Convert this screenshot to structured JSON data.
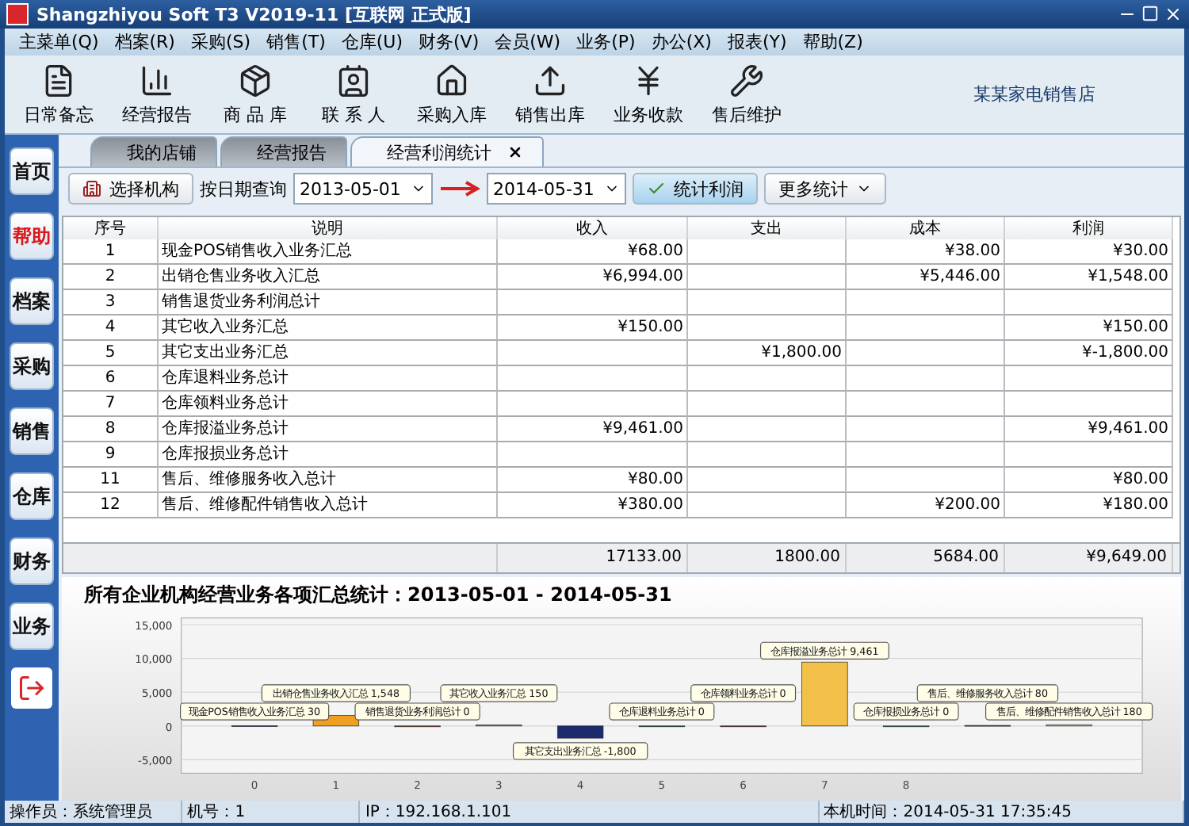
{
  "window": {
    "title": "Shangzhiyou Soft T3 V2019-11 [互联网 正式版]"
  },
  "menu": [
    "主菜单(Q)",
    "档案(R)",
    "采购(S)",
    "销售(T)",
    "仓库(U)",
    "财务(V)",
    "会员(W)",
    "业务(P)",
    "办公(X)",
    "报表(Y)",
    "帮助(Z)"
  ],
  "toolbar": [
    {
      "label": "日常备忘",
      "kind": "memo"
    },
    {
      "label": "经营报告",
      "kind": "report"
    },
    {
      "label": "商 品 库",
      "kind": "goods"
    },
    {
      "label": "联 系 人",
      "kind": "contact"
    },
    {
      "label": "采购入库",
      "kind": "purchase"
    },
    {
      "label": "销售出库",
      "kind": "sale"
    },
    {
      "label": "业务收款",
      "kind": "receipt"
    },
    {
      "label": "售后维护",
      "kind": "service"
    }
  ],
  "store_name": "某某家电销售店",
  "sidebar": {
    "items": [
      {
        "label": "首页",
        "selected": false
      },
      {
        "label": "帮助",
        "selected": true
      },
      {
        "label": "档案",
        "selected": false
      },
      {
        "label": "采购",
        "selected": false
      },
      {
        "label": "销售",
        "selected": false
      },
      {
        "label": "仓库",
        "selected": false
      },
      {
        "label": "财务",
        "selected": false
      },
      {
        "label": "业务",
        "selected": false
      }
    ]
  },
  "tabs": [
    {
      "label": "我的店铺",
      "selected": false,
      "closable": false
    },
    {
      "label": "经营报告",
      "selected": false,
      "closable": false
    },
    {
      "label": "经营利润统计",
      "selected": true,
      "closable": true
    }
  ],
  "filter": {
    "org_button": "选择机构",
    "date_label": "按日期查询",
    "date_from": "2013-05-01",
    "date_to": "2014-05-31",
    "stat_button": "统计利润",
    "more_button": "更多统计"
  },
  "table": {
    "columns": [
      "序号",
      "说明",
      "收入",
      "支出",
      "成本",
      "利润"
    ],
    "rows": [
      [
        "1",
        "现金POS销售收入业务汇总",
        "¥68.00",
        "",
        "¥38.00",
        "¥30.00"
      ],
      [
        "2",
        "出销仓售业务收入汇总",
        "¥6,994.00",
        "",
        "¥5,446.00",
        "¥1,548.00"
      ],
      [
        "3",
        "销售退货业务利润总计",
        "",
        "",
        "",
        ""
      ],
      [
        "4",
        "其它收入业务汇总",
        "¥150.00",
        "",
        "",
        "¥150.00"
      ],
      [
        "5",
        "其它支出业务汇总",
        "",
        "¥1,800.00",
        "",
        "¥-1,800.00"
      ],
      [
        "6",
        "仓库退料业务总计",
        "",
        "",
        "",
        ""
      ],
      [
        "7",
        "仓库领料业务总计",
        "",
        "",
        "",
        ""
      ],
      [
        "8",
        "仓库报溢业务总计",
        "¥9,461.00",
        "",
        "",
        "¥9,461.00"
      ],
      [
        "9",
        "仓库报损业务总计",
        "",
        "",
        "",
        ""
      ],
      [
        "11",
        "售后、维修服务收入总计",
        "¥80.00",
        "",
        "",
        "¥80.00"
      ],
      [
        "12",
        "售后、维修配件销售收入总计",
        "¥380.00",
        "",
        "¥200.00",
        "¥180.00"
      ]
    ],
    "totals": [
      "17133.00",
      "1800.00",
      "5684.00",
      "¥9,649.00"
    ]
  },
  "chart": {
    "chart_data": {
      "type": "bar",
      "title": "所有企业机构经营业务各项汇总统计：2013-05-01 - 2014-05-31",
      "x": [
        0,
        1,
        2,
        3,
        4,
        5,
        6,
        7,
        8,
        9,
        10
      ],
      "xlim": [
        -0.9,
        10.9
      ],
      "ylim": [
        -7000,
        16000
      ],
      "grid": true,
      "values": [
        30,
        1548,
        0,
        150,
        -1800,
        0,
        0,
        9461,
        0,
        80,
        180
      ],
      "colors": [
        "#1f3f8f",
        "#f0a020",
        "#e8361a",
        "#2aa4a8",
        "#1a2a6a",
        "#0e7a5a",
        "#b01018",
        "#f3c04a",
        "#2aa888",
        "#333333",
        "#e8dc7a"
      ],
      "value_labels": [
        "现金POS销售收入业务汇总 30",
        "出销仓售业务收入汇总 1,548",
        "销售退货业务利润总计 0",
        "其它收入业务汇总 150",
        "其它支出业务汇总 -1,800",
        "仓库退料业务总计 0",
        "仓库领料业务总计 0",
        "仓库报溢业务总计 9,461",
        "仓库报损业务总计 0",
        "售后、维修服务收入总计 80",
        "售后、维修配件销售收入总计 180"
      ],
      "xticks": [
        0,
        1,
        2,
        3,
        4,
        5,
        6,
        7,
        8
      ],
      "yticks": [
        {
          "value": -5000,
          "label": "-5,000"
        },
        {
          "value": 0,
          "label": "0"
        },
        {
          "value": 5000,
          "label": "5,000"
        },
        {
          "value": 10000,
          "label": "10,000"
        },
        {
          "value": 15000,
          "label": "15,000"
        }
      ]
    }
  },
  "status_bar": [
    {
      "label": "操作员：",
      "value": "系统管理员"
    },
    {
      "label": "机号：",
      "value": "1"
    },
    {
      "label": "IP：",
      "value": "192.168.1.101"
    },
    {
      "label": "本机时间：",
      "value": "2014-05-31 17:35:45"
    }
  ]
}
